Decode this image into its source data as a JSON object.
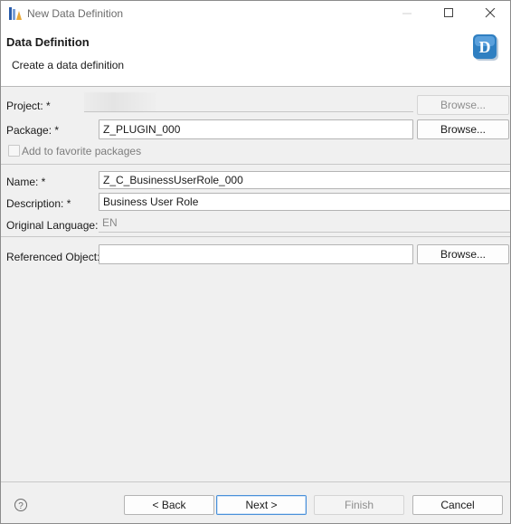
{
  "window": {
    "title": "New Data Definition"
  },
  "banner": {
    "title": "Data Definition",
    "message": "Create a data definition",
    "icon_letter": "D"
  },
  "form": {
    "project_label": "Project: *",
    "project_browse": "Browse...",
    "package_label": "Package: *",
    "package_value": "Z_PLUGIN_000",
    "package_browse": "Browse...",
    "favorite_label": "Add to favorite packages",
    "name_label": "Name: *",
    "name_value": "Z_C_BusinessUserRole_000",
    "description_label": "Description: *",
    "description_value": "Business User Role",
    "language_label": "Original Language:",
    "language_value": "EN",
    "refobj_label": "Referenced Object:",
    "refobj_value": "",
    "refobj_browse": "Browse..."
  },
  "footer": {
    "help_icon": "question-circle-icon",
    "back_label": "< Back",
    "next_label": "Next >",
    "finish_label": "Finish",
    "cancel_label": "Cancel"
  },
  "colors": {
    "accent": "#4a90d9",
    "badge_blue": "#2f7fc1"
  }
}
